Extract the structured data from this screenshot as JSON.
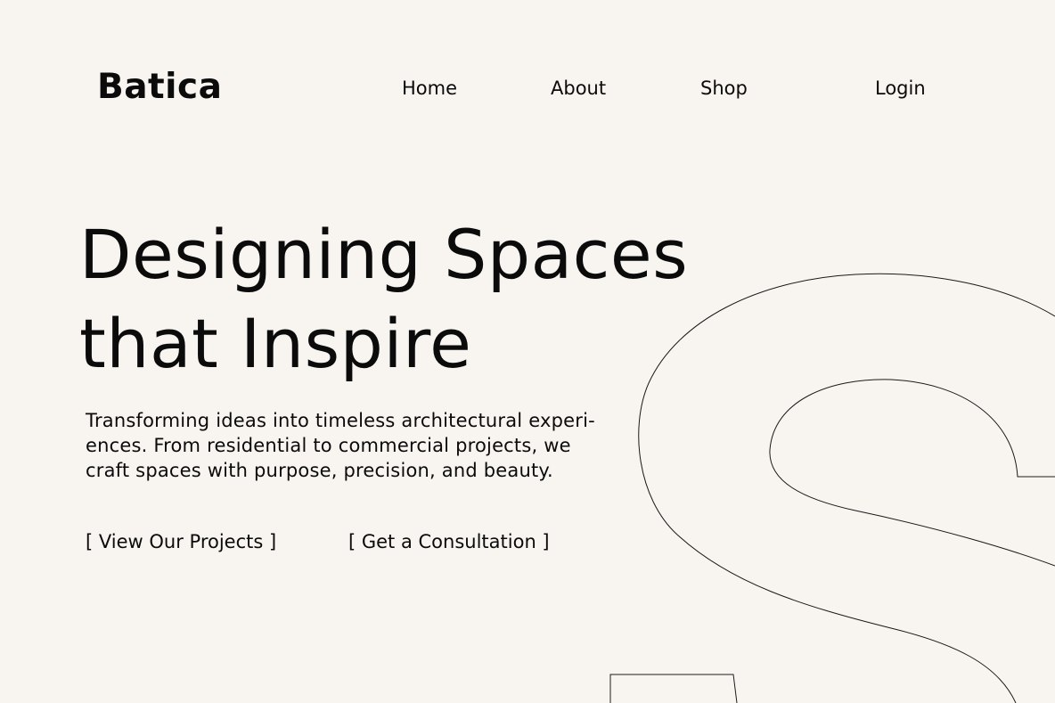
{
  "header": {
    "brand": "Batica",
    "nav": {
      "home": "Home",
      "about": "About",
      "shop": "Shop",
      "login": "Login"
    }
  },
  "hero": {
    "headline": [
      "Designing Spaces",
      "that Inspire"
    ],
    "description": [
      "Transforming ideas into timeless architectural experi-",
      "ences. From residential to commercial projects, we",
      "craft spaces with purpose, precision, and beauty."
    ],
    "cta_primary": "[ View Our Projects ]",
    "cta_secondary": "[ Get a Consultation ]"
  },
  "decor": {
    "outline_letter": "S",
    "background_color": "#f8f5f1",
    "text_color": "#0b0b0b"
  }
}
